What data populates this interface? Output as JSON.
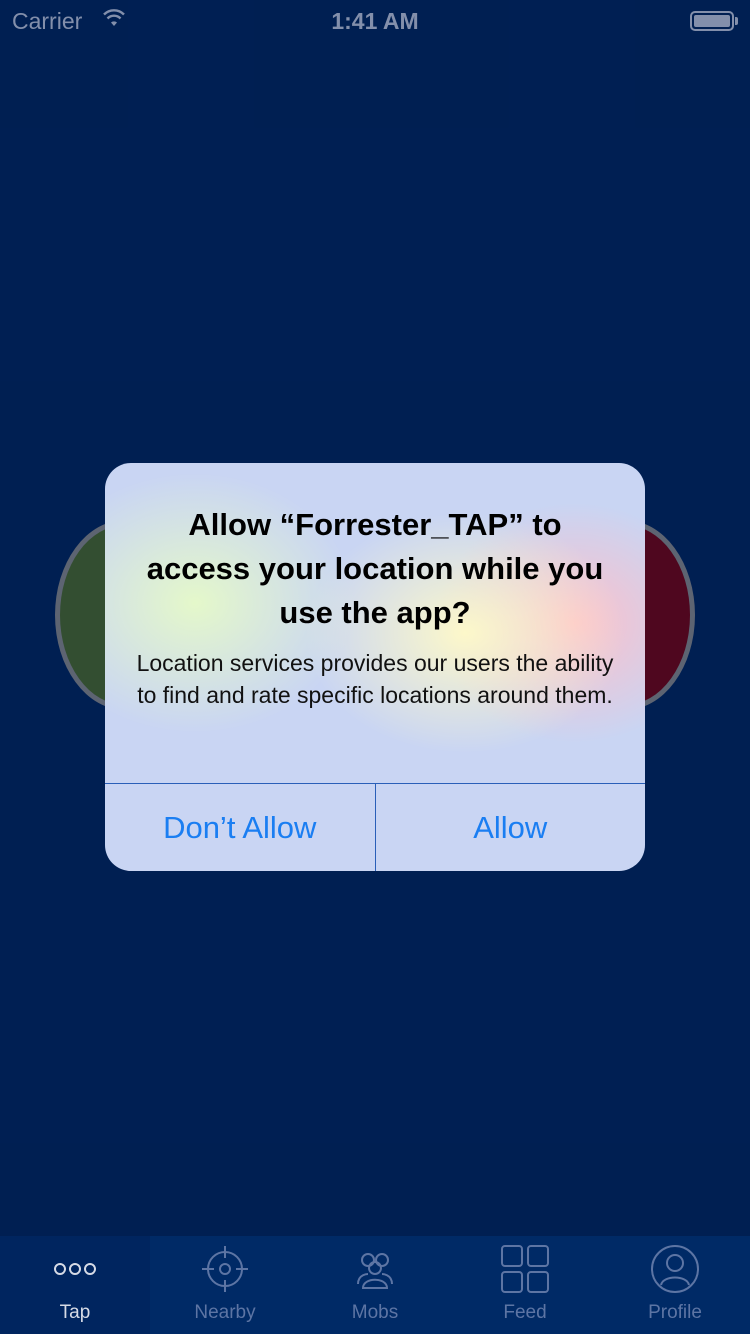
{
  "status_bar": {
    "carrier": "Carrier",
    "time": "1:41 AM",
    "wifi_icon": "wifi-icon",
    "battery_icon": "battery-icon"
  },
  "alert": {
    "title": "Allow “Forrester_TAP” to access your location while you use the app?",
    "message": "Location services provides our users the ability to find and rate specific locations around them.",
    "dont_allow_label": "Don’t Allow",
    "allow_label": "Allow"
  },
  "tab_bar": {
    "items": [
      {
        "label": "Tap",
        "icon": "more-dots-icon",
        "active": true
      },
      {
        "label": "Nearby",
        "icon": "crosshair-icon",
        "active": false
      },
      {
        "label": "Mobs",
        "icon": "group-icon",
        "active": false
      },
      {
        "label": "Feed",
        "icon": "grid-icon",
        "active": false
      },
      {
        "label": "Profile",
        "icon": "profile-icon",
        "active": false
      }
    ]
  },
  "colors": {
    "background": "#00255f",
    "accent": "#1a7ef2",
    "green_button": "#4f6d2c",
    "red_button": "#7a0010"
  }
}
